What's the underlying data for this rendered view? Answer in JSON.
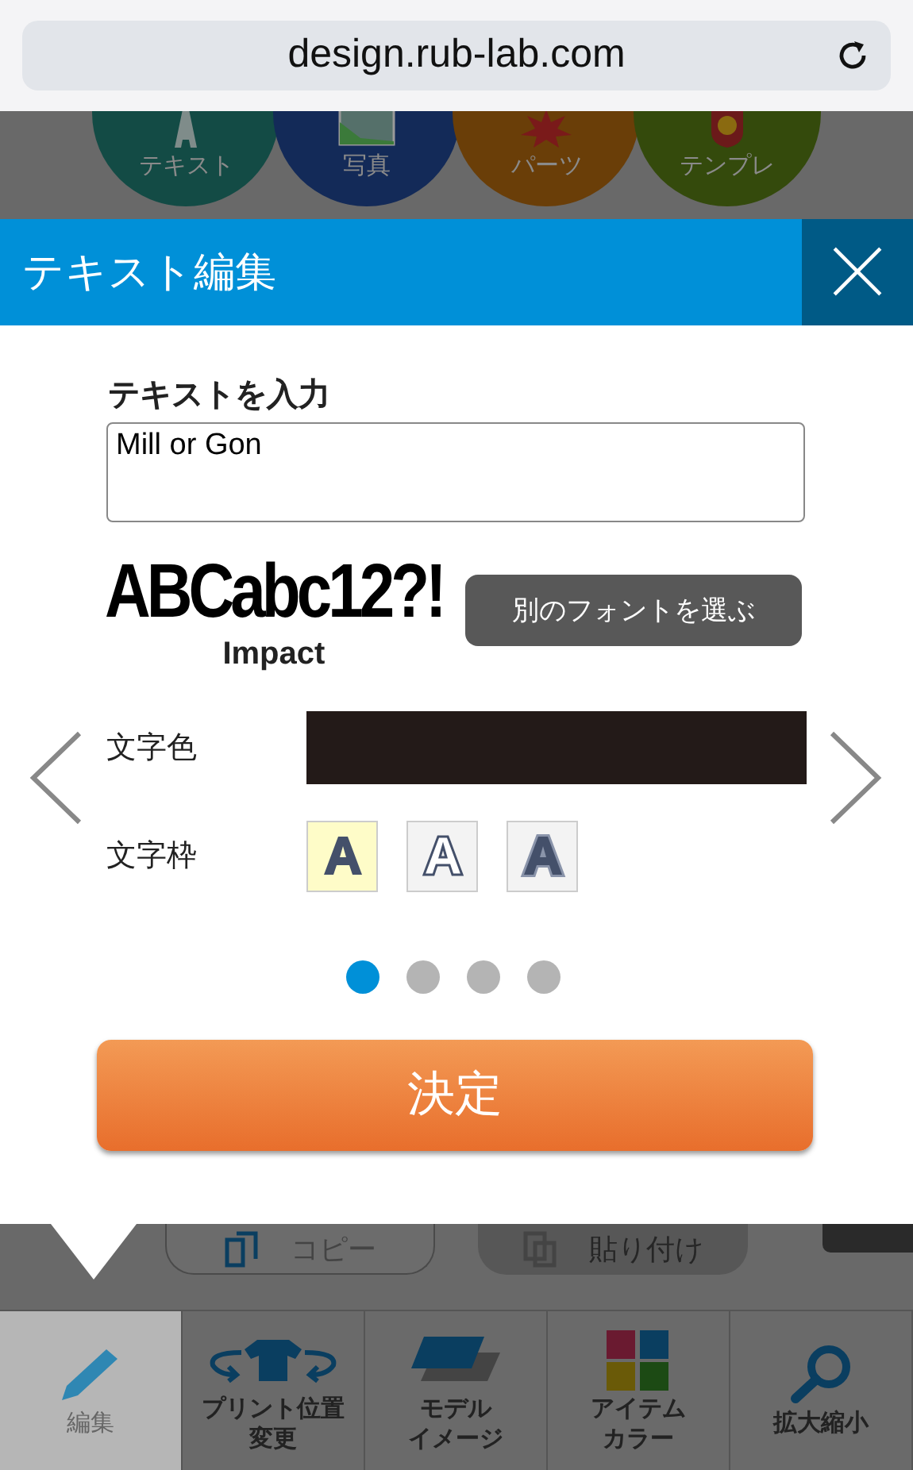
{
  "browser": {
    "url": "design.rub-lab.com"
  },
  "categories": [
    {
      "label": "テキスト",
      "color": "#134b45"
    },
    {
      "label": "写真",
      "color": "#132a58"
    },
    {
      "label": "パーツ",
      "color": "#6a3e08"
    },
    {
      "label": "テンプレ",
      "color": "#344a0c"
    }
  ],
  "dialog": {
    "title": "テキスト編集",
    "text_label": "テキストを入力",
    "text_value": "Mill or Gon",
    "font_sample": "ABCabc12?!",
    "font_name": "Impact",
    "font_button": "別のフォントを選ぶ",
    "color_label": "文字色",
    "border_label": "文字枠",
    "border_styles": [
      {
        "kind": "plain",
        "selected": true
      },
      {
        "kind": "outline",
        "selected": false
      },
      {
        "kind": "double",
        "selected": false
      }
    ],
    "pages": [
      {
        "selected": true
      },
      {
        "selected": false
      },
      {
        "selected": false
      },
      {
        "selected": false
      }
    ],
    "confirm": "決定"
  },
  "toolbar": {
    "copy": "コピー",
    "paste": "貼り付け"
  },
  "nav": [
    {
      "lines": [
        "編集"
      ],
      "selected": true
    },
    {
      "lines": [
        "プリント位置",
        "変更"
      ],
      "selected": false
    },
    {
      "lines": [
        "モデル",
        "イメージ"
      ],
      "selected": false
    },
    {
      "lines": [
        "アイテム",
        "カラー"
      ],
      "selected": false
    },
    {
      "lines": [
        "拡大縮小"
      ],
      "selected": false
    }
  ]
}
